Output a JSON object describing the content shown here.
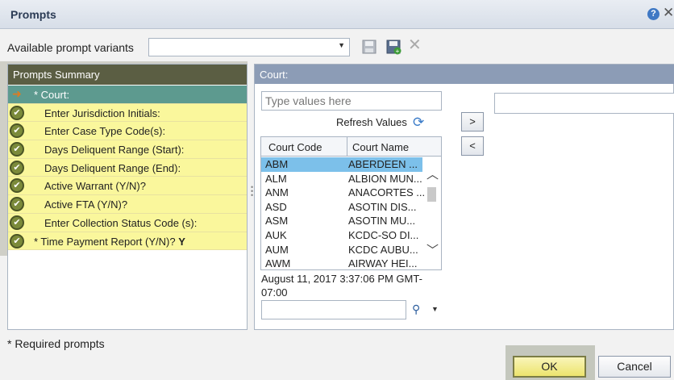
{
  "dialog": {
    "title": "Prompts"
  },
  "variants": {
    "label": "Available prompt variants",
    "selected": ""
  },
  "summary": {
    "header": "Prompts Summary",
    "items": [
      {
        "label": "* Court:",
        "state": "active",
        "required": true
      },
      {
        "label": "Enter Jurisdiction Initials:",
        "state": "ok",
        "required": false
      },
      {
        "label": "Enter Case Type Code(s):",
        "state": "ok",
        "required": false
      },
      {
        "label": "Days Deliquent Range (Start):",
        "state": "ok",
        "required": false
      },
      {
        "label": "Days Deliquent Range (End):",
        "state": "ok",
        "required": false
      },
      {
        "label": "Active Warrant (Y/N)?",
        "state": "ok",
        "required": false
      },
      {
        "label": "Active FTA (Y/N)?",
        "state": "ok",
        "required": false
      },
      {
        "label": "Enter Collection Status Code (s):",
        "state": "ok",
        "required": false
      },
      {
        "label": "* Time Payment Report (Y/N)?",
        "value": "Y",
        "state": "ok",
        "required": true
      }
    ]
  },
  "court": {
    "header": "Court:",
    "type_placeholder": "Type values here",
    "refresh_label": "Refresh Values",
    "columns": [
      "Court Code",
      "Court Name"
    ],
    "rows": [
      {
        "code": "ABM",
        "name": "ABERDEEN ...",
        "selected": true
      },
      {
        "code": "ALM",
        "name": "ALBION MUN..."
      },
      {
        "code": "ANM",
        "name": "ANACORTES ..."
      },
      {
        "code": "ASD",
        "name": "ASOTIN DIS..."
      },
      {
        "code": "ASM",
        "name": "ASOTIN MU..."
      },
      {
        "code": "AUK",
        "name": "KCDC-SO DI..."
      },
      {
        "code": "AUM",
        "name": "KCDC AUBU..."
      },
      {
        "code": "AWM",
        "name": "AIRWAY HEI..."
      }
    ],
    "timestamp": "August 11, 2017 3:37:06 PM GMT-07:00",
    "add_label": ">",
    "remove_label": "<"
  },
  "footer": {
    "required_note": "* Required prompts",
    "ok_label": "OK",
    "cancel_label": "Cancel"
  },
  "colors": {
    "summary_header": "#5b5e43",
    "row_fill": "#faf79c",
    "active_row": "#5d9a8f",
    "court_header": "#8c9cb6",
    "selected_row": "#7cc0ea"
  }
}
